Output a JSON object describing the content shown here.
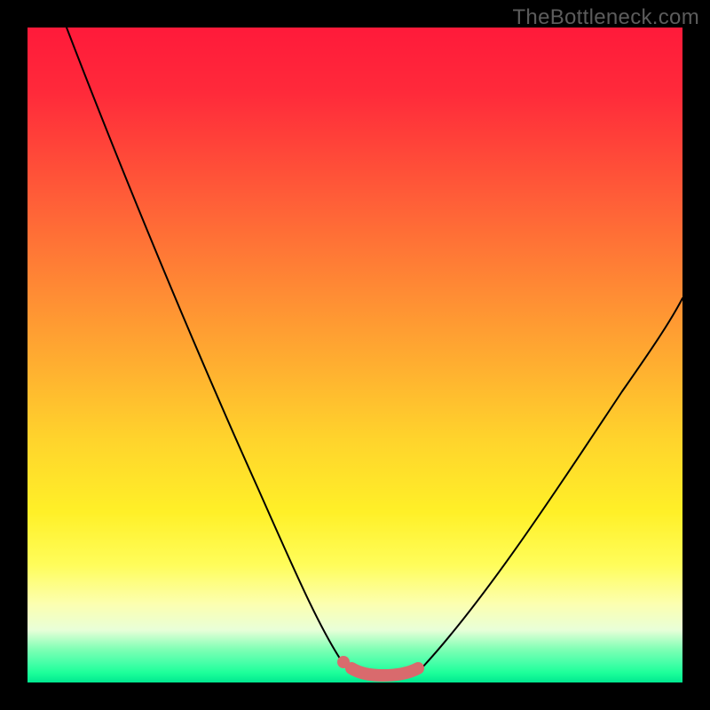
{
  "watermark": "TheBottleneck.com",
  "chart_data": {
    "type": "line",
    "title": "",
    "xlabel": "",
    "ylabel": "",
    "xlim": [
      0,
      100
    ],
    "ylim": [
      0,
      100
    ],
    "grid": false,
    "legend": false,
    "series": [
      {
        "name": "bottleneck-curve-left",
        "x": [
          6,
          10,
          15,
          20,
          25,
          30,
          35,
          40,
          45,
          48
        ],
        "y": [
          100,
          89,
          76,
          64,
          52,
          40,
          28,
          16,
          5,
          2
        ]
      },
      {
        "name": "bottleneck-curve-right",
        "x": [
          60,
          65,
          70,
          75,
          80,
          85,
          90,
          95,
          100
        ],
        "y": [
          2,
          8,
          16,
          25,
          33,
          41,
          48,
          54,
          59
        ]
      },
      {
        "name": "optimal-zone",
        "x": [
          49,
          52,
          55,
          58,
          60
        ],
        "y": [
          2,
          1.2,
          1.2,
          1.3,
          2
        ]
      }
    ],
    "marker": {
      "name": "optimal-dot",
      "x": 48.5,
      "y": 3
    },
    "colors": {
      "gradient_top": "#ff1a3a",
      "gradient_mid": "#ffd42c",
      "gradient_bottom": "#00e890",
      "curve": "#000000",
      "optimal": "#d96a6d",
      "frame": "#000000"
    }
  }
}
